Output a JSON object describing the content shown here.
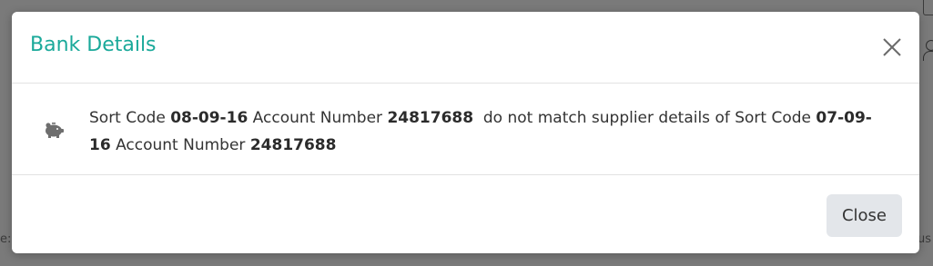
{
  "background": {
    "left_fragment": "e:",
    "right_fragment": "us"
  },
  "modal": {
    "title": "Bank Details",
    "close_icon": "close-x-icon",
    "body": {
      "icon": "piggy-bank-icon",
      "message": {
        "part1": "Sort Code ",
        "sort_code_given": "08-09-16",
        "part2": " Account Number ",
        "account_given": "24817688",
        "part3": "  do not match supplier details of Sort Code ",
        "sort_code_supplier": "07-09-16",
        "part4": " Account Number ",
        "account_supplier": "24817688"
      }
    },
    "footer": {
      "close_label": "Close"
    }
  },
  "colors": {
    "title": "#1aa99a",
    "backdrop": "#7a7a7a",
    "button_bg": "#e3e6ea"
  }
}
